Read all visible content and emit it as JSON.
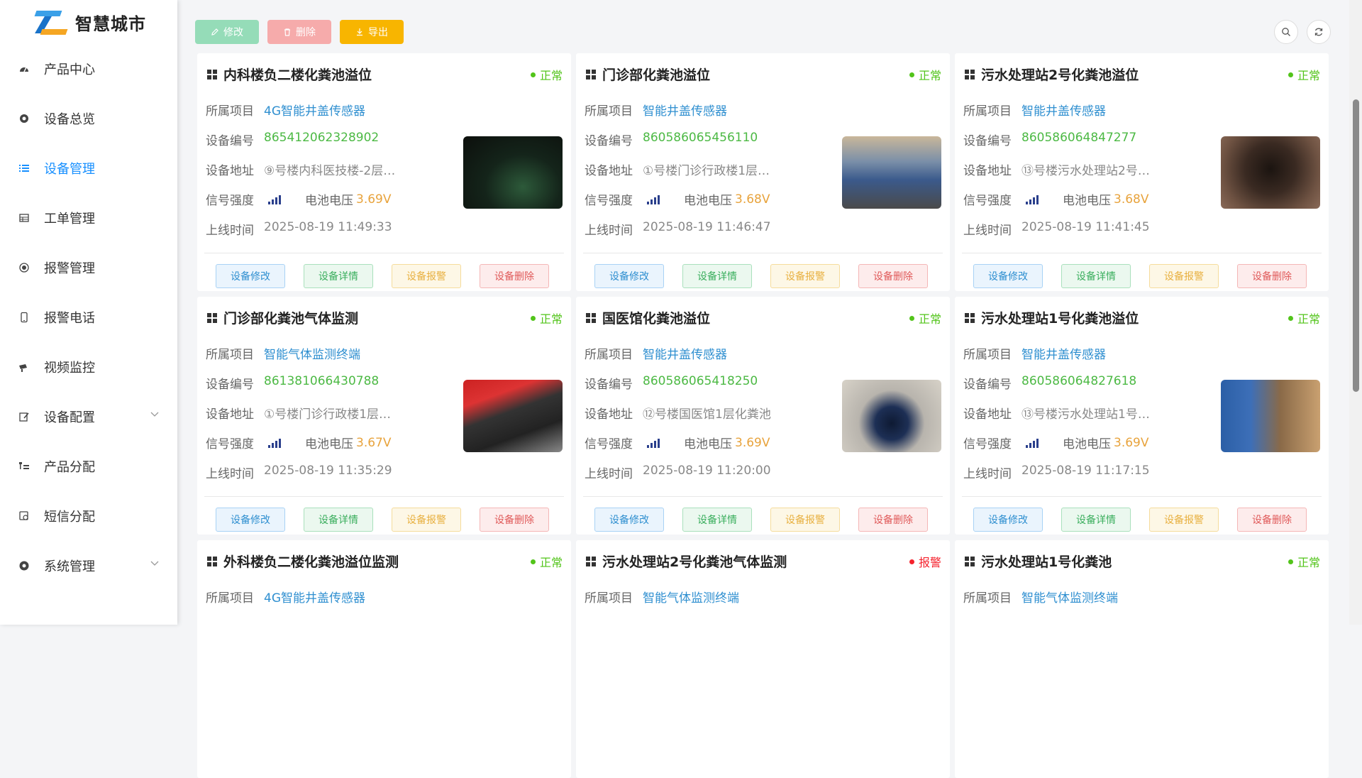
{
  "brand": {
    "name": "智慧城市"
  },
  "sidebar": {
    "items": [
      {
        "label": "产品中心",
        "icon": "dashboard-icon",
        "active": false,
        "expandable": false
      },
      {
        "label": "设备总览",
        "icon": "gear-icon",
        "active": false,
        "expandable": false
      },
      {
        "label": "设备管理",
        "icon": "list-icon",
        "active": true,
        "expandable": false
      },
      {
        "label": "工单管理",
        "icon": "table-icon",
        "active": false,
        "expandable": false
      },
      {
        "label": "报警管理",
        "icon": "radio-icon",
        "active": false,
        "expandable": false
      },
      {
        "label": "报警电话",
        "icon": "phone-icon",
        "active": false,
        "expandable": false
      },
      {
        "label": "视频监控",
        "icon": "camera-icon",
        "active": false,
        "expandable": false
      },
      {
        "label": "设备配置",
        "icon": "edit-icon",
        "active": false,
        "expandable": true
      },
      {
        "label": "产品分配",
        "icon": "tree-icon",
        "active": false,
        "expandable": false
      },
      {
        "label": "短信分配",
        "icon": "sms-icon",
        "active": false,
        "expandable": false
      },
      {
        "label": "系统管理",
        "icon": "settings-icon",
        "active": false,
        "expandable": true
      }
    ]
  },
  "toolbar": {
    "edit": "修改",
    "delete": "删除",
    "export": "导出"
  },
  "labels": {
    "project": "所属项目",
    "code": "设备编号",
    "address": "设备地址",
    "signal": "信号强度",
    "battery": "电池电压",
    "online": "上线时间"
  },
  "card_actions": {
    "edit": "设备修改",
    "detail": "设备详情",
    "alarm": "设备报警",
    "delete": "设备删除"
  },
  "colors": {
    "normal": "#52c41a",
    "alarm": "#f5222d",
    "accent": "#1890ff"
  },
  "devices": [
    {
      "title": "内科楼负二楼化粪池溢位",
      "status": "正常",
      "status_type": "normal",
      "project": "4G智能井盖传感器",
      "code": "865412062328902",
      "address": "⑨号楼内科医技楼-2层…",
      "battery": "3.69V",
      "online": "2025-08-19 11:49:33",
      "photo": "dark"
    },
    {
      "title": "门诊部化粪池溢位",
      "status": "正常",
      "status_type": "normal",
      "project": "智能井盖传感器",
      "code": "860586065456110",
      "address": "①号楼门诊行政楼1层…",
      "battery": "3.68V",
      "online": "2025-08-19 11:46:47",
      "photo": "worker"
    },
    {
      "title": "污水处理站2号化粪池溢位",
      "status": "正常",
      "status_type": "normal",
      "project": "智能井盖传感器",
      "code": "860586064847277",
      "address": "⑬号楼污水处理站2号…",
      "battery": "3.68V",
      "online": "2025-08-19 11:41:45",
      "photo": "brown"
    },
    {
      "title": "门诊部化粪池气体监测",
      "status": "正常",
      "status_type": "normal",
      "project": "智能气体监测终端",
      "code": "861381066430788",
      "address": "①号楼门诊行政楼1层…",
      "battery": "3.67V",
      "online": "2025-08-19 11:35:29",
      "photo": "red"
    },
    {
      "title": "国医馆化粪池溢位",
      "status": "正常",
      "status_type": "normal",
      "project": "智能井盖传感器",
      "code": "860586065418250",
      "address": "⑫号楼国医馆1层化粪池",
      "battery": "3.69V",
      "online": "2025-08-19 11:20:00",
      "photo": "well"
    },
    {
      "title": "污水处理站1号化粪池溢位",
      "status": "正常",
      "status_type": "normal",
      "project": "智能井盖传感器",
      "code": "860586064827618",
      "address": "⑬号楼污水处理站1号…",
      "battery": "3.69V",
      "online": "2025-08-19 11:17:15",
      "photo": "man"
    },
    {
      "title": "外科楼负二楼化粪池溢位监测",
      "status": "正常",
      "status_type": "normal",
      "project": "4G智能井盖传感器",
      "code": "",
      "address": "",
      "battery": "",
      "online": "",
      "photo": "none"
    },
    {
      "title": "污水处理站2号化粪池气体监测",
      "status": "报警",
      "status_type": "alarm",
      "project": "智能气体监测终端",
      "code": "",
      "address": "",
      "battery": "",
      "online": "",
      "photo": "none"
    },
    {
      "title": "污水处理站1号化粪池",
      "status": "正常",
      "status_type": "normal",
      "project": "智能气体监测终端",
      "code": "",
      "address": "",
      "battery": "",
      "online": "",
      "photo": "none"
    }
  ]
}
